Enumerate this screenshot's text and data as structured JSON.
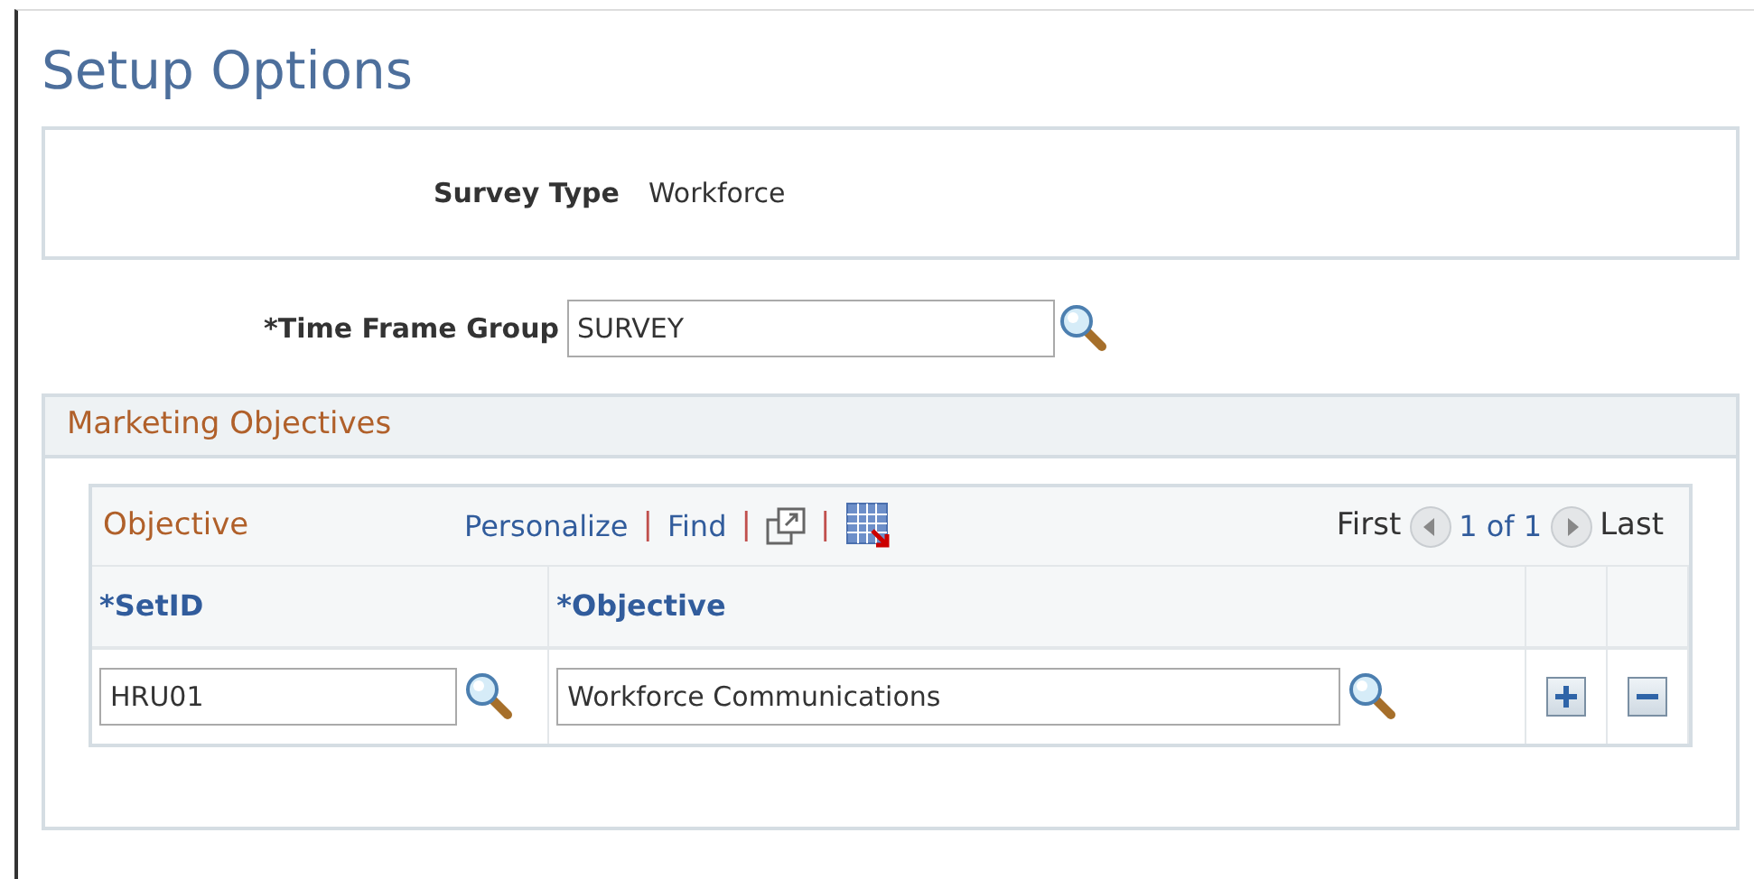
{
  "page_title": "Setup Options",
  "survey_type": {
    "label": "Survey Type",
    "value": "Workforce"
  },
  "time_frame_group": {
    "label": "*Time Frame Group",
    "value": "SURVEY"
  },
  "group": {
    "title": "Marketing Objectives",
    "grid": {
      "title": "Objective",
      "toolbar": [
        {
          "kind": "link",
          "text": "Personalize"
        },
        {
          "kind": "separator",
          "text": "|"
        },
        {
          "kind": "link",
          "text": "Find"
        },
        {
          "kind": "separator",
          "text": "|"
        },
        {
          "kind": "zoom"
        },
        {
          "kind": "separator",
          "text": "|"
        },
        {
          "kind": "download"
        }
      ],
      "first": "First",
      "count": "1 of 1",
      "last": "Last",
      "columns": [
        "*SetID",
        "*Objective"
      ],
      "rows": [
        {
          "setid": "HRU01",
          "objective": "Workforce Communications"
        }
      ]
    }
  }
}
